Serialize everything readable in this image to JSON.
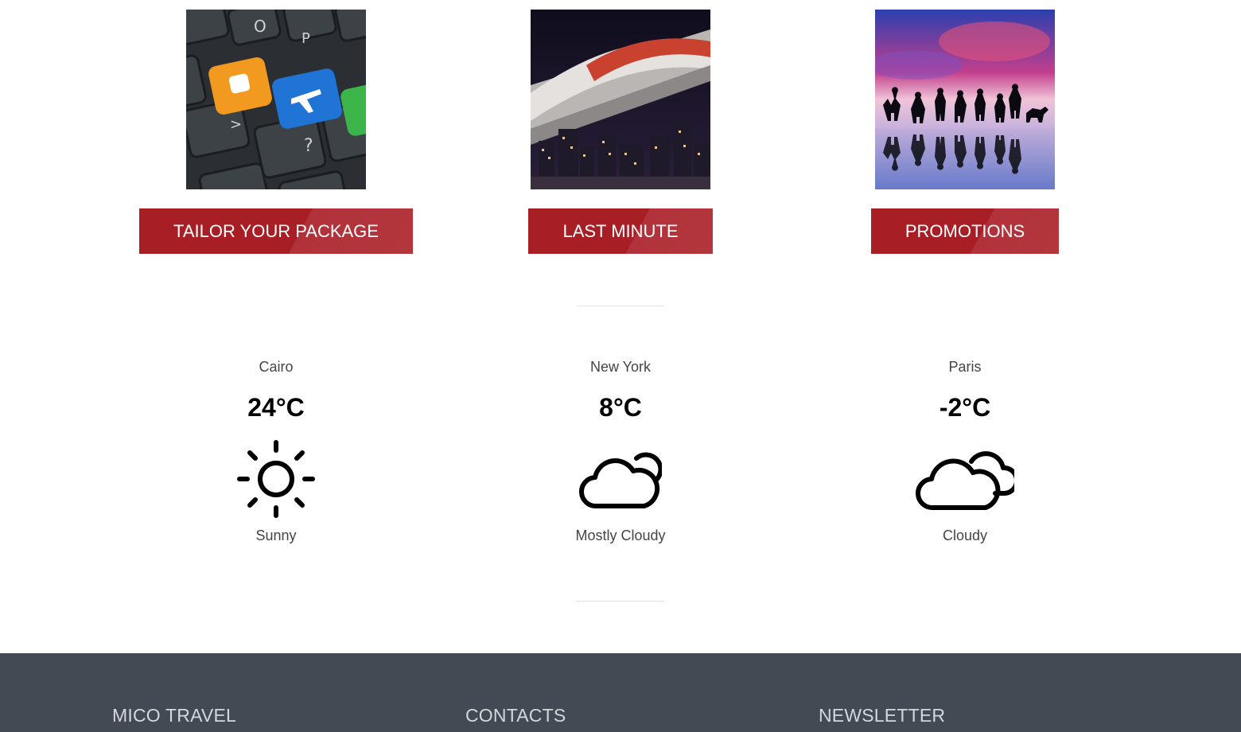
{
  "cards": [
    {
      "label": "TAILOR YOUR PACKAGE",
      "image": "keyboard-travel-keys-photo"
    },
    {
      "label": "LAST MINUTE",
      "image": "monorail-city-night-photo"
    },
    {
      "label": "PROMOTIONS",
      "image": "people-jumping-beach-sunset-photo"
    }
  ],
  "weather": [
    {
      "city": "Cairo",
      "temp": "24°C",
      "condition": "Sunny",
      "icon": "sun-icon"
    },
    {
      "city": "New York",
      "temp": "8°C",
      "condition": "Mostly Cloudy",
      "icon": "mostly-cloudy-icon"
    },
    {
      "city": "Paris",
      "temp": "-2°C",
      "condition": "Cloudy",
      "icon": "cloudy-icon"
    }
  ],
  "footer": {
    "col1_title": "MICO TRAVEL",
    "col2_title": "CONTACTS",
    "col3_title": "NEWSLETTER"
  },
  "colors": {
    "button_red": "#a81e25",
    "footer_bg": "#434a54",
    "footer_title": "#d4d7dc"
  }
}
